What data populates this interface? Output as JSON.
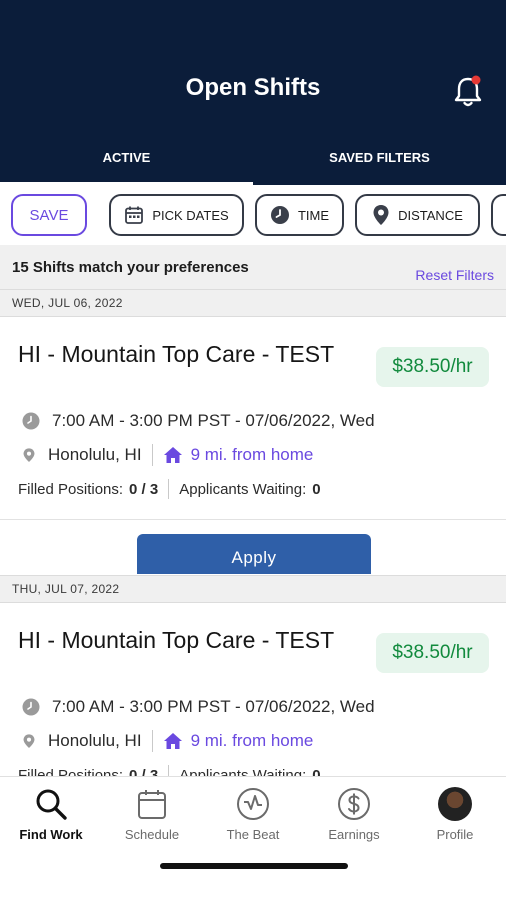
{
  "header": {
    "title": "Open Shifts",
    "tabs": [
      {
        "label": "ACTIVE",
        "active": true
      },
      {
        "label": "SAVED FILTERS",
        "active": false
      }
    ],
    "notification_badge_color": "#e53935"
  },
  "filters": {
    "save_label": "SAVE",
    "pick_dates_label": "PICK DATES",
    "time_label": "TIME",
    "distance_label": "DISTANCE"
  },
  "results": {
    "match_text": "15 Shifts match your preferences",
    "reset_label": "Reset Filters"
  },
  "groups": [
    {
      "date": "WED, JUL 06, 2022",
      "shift": {
        "title": "HI - Mountain Top Care - TEST",
        "rate": "$38.50/hr",
        "time": "7:00 AM - 3:00 PM PST - 07/06/2022, Wed",
        "location": "Honolulu, HI",
        "distance": "9 mi. from home",
        "filled_label": "Filled Positions:",
        "filled_value": "0 / 3",
        "applicants_label": "Applicants Waiting:",
        "applicants_value": "0",
        "apply_label": "Apply"
      }
    },
    {
      "date": "THU, JUL 07, 2022",
      "shift": {
        "title": "HI - Mountain Top Care - TEST",
        "rate": "$38.50/hr",
        "time": "7:00 AM - 3:00 PM PST - 07/06/2022, Wed",
        "location": "Honolulu, HI",
        "distance": "9 mi. from home",
        "filled_label": "Filled Positions:",
        "filled_value": "0 / 3",
        "applicants_label": "Applicants Waiting:",
        "applicants_value": "0"
      }
    }
  ],
  "bottom_nav": [
    {
      "label": "Find Work",
      "icon": "search-icon",
      "active": true
    },
    {
      "label": "Schedule",
      "icon": "calendar-icon",
      "active": false
    },
    {
      "label": "The Beat",
      "icon": "beat-icon",
      "active": false
    },
    {
      "label": "Earnings",
      "icon": "dollar-icon",
      "active": false
    },
    {
      "label": "Profile",
      "icon": "avatar",
      "active": false
    }
  ],
  "colors": {
    "header_bg": "#0b1d3a",
    "accent": "#6a49e0",
    "rate_green": "#118a3d",
    "apply_blue": "#2f5fa8"
  }
}
